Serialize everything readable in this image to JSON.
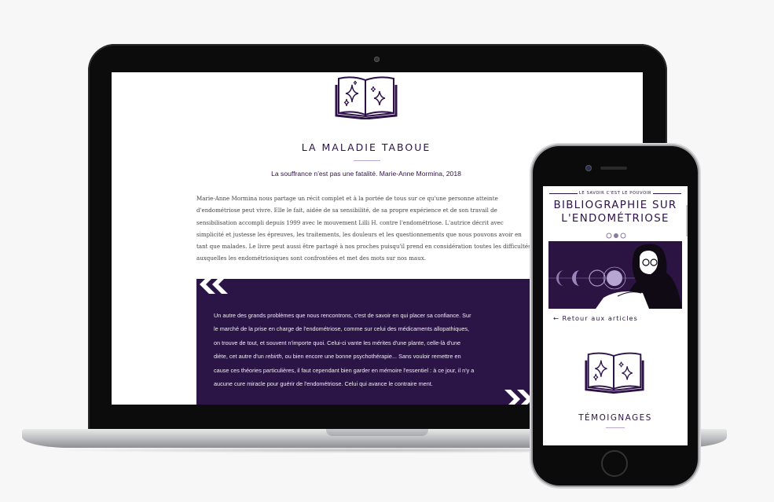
{
  "laptop_page": {
    "title": "LA MALADIE TABOUE",
    "subtitle": "La souffrance n'est pas une fatalité. Marie-Anne Mormina, 2018",
    "body_lines": [
      "Marie-Anne Mormina nous partage un récit complet et à la portée de tous sur ce qu'une personne atteinte",
      "d'endométriose peut vivre. Elle le fait, aidée de sa sensibilité, de sa propre expérience et de son travail de",
      "sensibilisation accompli depuis 1999 avec le mouvement Lilli H. contre l'endométriose. L'autrice décrit avec",
      "simplicité et justesse les épreuves, les traitements, les douleurs et les questionnements que nous pouvons avoir en",
      "tant que malades. Le livre peut aussi être partagé à nos proches puisqu'il prend en considération toutes les difficultés",
      "auxquelles les endométriosiques sont confrontées et met des mots sur nos maux."
    ],
    "quote_lines": [
      "Un autre des grands problèmes que nous rencontrons, c'est de savoir en qui placer sa confiance. Sur",
      "le marché de la prise en charge de l'endométriose, comme sur celui des médicaments allopathiques,",
      "on trouve de tout, et souvent n'importe quoi. Celui-ci vante les mérites d'une plante, celle-là d'une",
      "cause ces théories particulières, il faut cependant bien garder en mémoire l'essentiel : à ce jour, il n'y a",
      "aucune cure miracle pour guérir de l'endométriose. Celui qui avance le contraire ment."
    ],
    "quote_line4_before": "diète, cet autre d'un ",
    "quote_line4_em": "rebirth",
    "quote_line4_after": ", ou bien encore une bonne psychothérapie... Sans vouloir remettre en"
  },
  "phone_page": {
    "tagline": "LE SAVOIR C'EST LE POUVOIR",
    "title_line1": "BIBLIOGRAPHIE SUR",
    "title_line2": "L'ENDOMÉTRIOSE",
    "back_link": "← Retour aux articles",
    "section_title": "TÉMOIGNAGES"
  },
  "colors": {
    "brand_purple": "#2d1248",
    "quote_bg": "#2b1446",
    "accent_lilac": "#bda8cf"
  },
  "icons": [
    "book-sparkles-icon",
    "open-quote-icon",
    "close-quote-icon",
    "moon-phases-ornament-icon"
  ]
}
